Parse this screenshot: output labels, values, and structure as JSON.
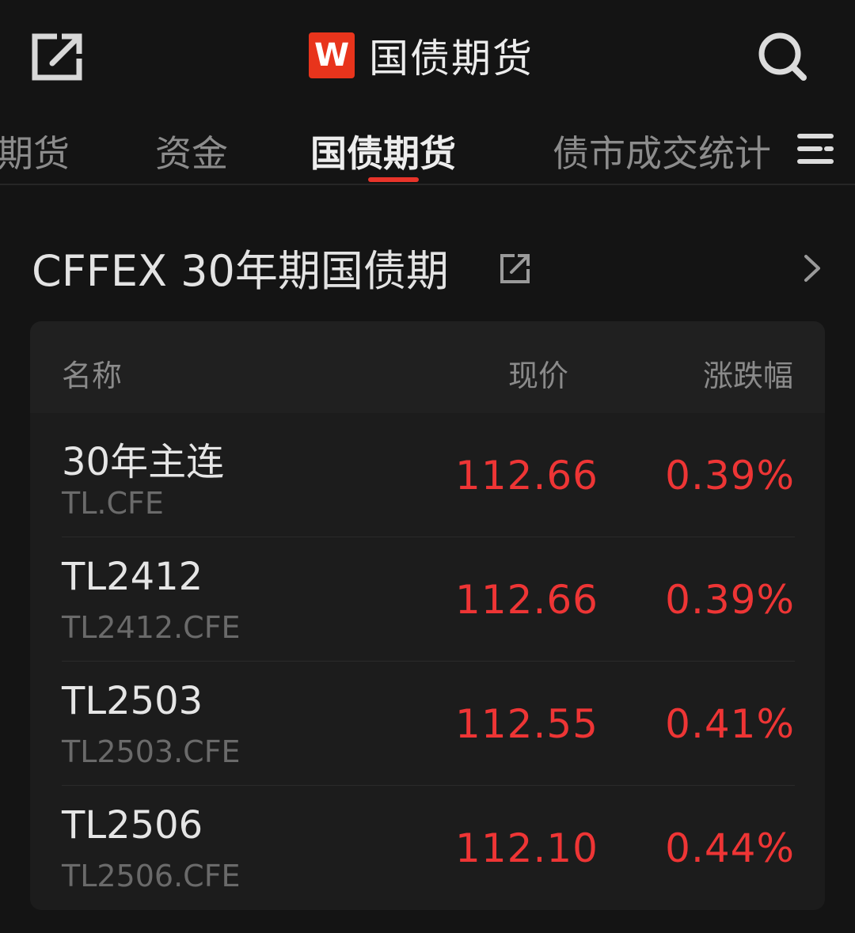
{
  "header": {
    "logo_letter": "W",
    "title": "国债期货",
    "share_icon": "share-icon",
    "search_icon": "search-icon"
  },
  "tabs": [
    {
      "label": "期货",
      "active": false
    },
    {
      "label": "资金",
      "active": false
    },
    {
      "label": "国债期货",
      "active": true
    },
    {
      "label": "债市成交统计",
      "active": false
    }
  ],
  "section": {
    "title": "CFFEX 30年期国债期",
    "share_icon": "share-icon",
    "arrow_icon": "chevron-right-icon"
  },
  "table": {
    "columns": {
      "name": "名称",
      "price": "现价",
      "change": "涨跌幅"
    },
    "rows": [
      {
        "name": "30年主连",
        "code": "TL.CFE",
        "price": "112.66",
        "change": "0.39%"
      },
      {
        "name": "TL2412",
        "code": "TL2412.CFE",
        "price": "112.66",
        "change": "0.39%"
      },
      {
        "name": "TL2503",
        "code": "TL2503.CFE",
        "price": "112.55",
        "change": "0.41%"
      },
      {
        "name": "TL2506",
        "code": "TL2506.CFE",
        "price": "112.10",
        "change": "0.44%"
      }
    ]
  },
  "colors": {
    "accent": "#e8342a",
    "up": "#ee3535",
    "background": "#141414",
    "logo": "#e8341c"
  }
}
